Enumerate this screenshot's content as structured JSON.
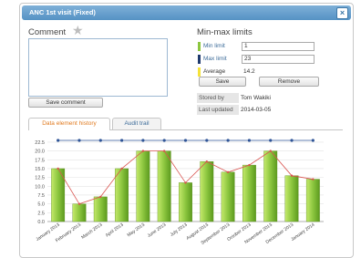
{
  "dialog": {
    "title": "ANC 1st visit (Fixed)",
    "close_label": "×"
  },
  "comment": {
    "title": "Comment",
    "value": "",
    "save_label": "Save comment"
  },
  "minmax": {
    "title": "Min-max limits",
    "min": {
      "label": "Min limit",
      "value": "1",
      "color": "#8cc63f"
    },
    "max": {
      "label": "Max limit",
      "value": "23",
      "color": "#1f3a6e"
    },
    "avg": {
      "label": "Average",
      "value": "14.2",
      "color": "#f5e23a"
    },
    "save_label": "Save",
    "remove_label": "Remove"
  },
  "meta": {
    "stored_by_label": "Stored by",
    "stored_by": "Tom Wakiki",
    "updated_label": "Last updated",
    "updated": "2014-03-05"
  },
  "tabs": [
    {
      "label": "Data element history"
    },
    {
      "label": "Audit trail"
    }
  ],
  "chart_data": {
    "type": "bar",
    "categories": [
      "January 2013",
      "February 2013",
      "March 2013",
      "April 2013",
      "May 2013",
      "June 2013",
      "July 2013",
      "August 2013",
      "September 2013",
      "October 2013",
      "November 2013",
      "December 2013",
      "January 2014"
    ],
    "series": [
      {
        "type": "bar",
        "values": [
          15,
          5,
          7,
          15,
          20,
          20,
          11,
          17,
          14,
          16,
          20,
          13,
          12
        ],
        "color": "#8cc63f"
      },
      {
        "type": "line",
        "values": [
          15,
          5,
          7,
          15,
          20,
          20,
          11,
          17,
          14,
          16,
          20,
          13,
          12
        ],
        "color": "#d9534f"
      },
      {
        "type": "line",
        "values": [
          23,
          23,
          23,
          23,
          23,
          23,
          23,
          23,
          23,
          23,
          23,
          23,
          23
        ],
        "color": "#2f5597"
      }
    ],
    "yticks": [
      "0.0",
      "2.5",
      "5.0",
      "7.5",
      "10.0",
      "12.5",
      "15.0",
      "17.5",
      "20.0",
      "22.5"
    ],
    "ylim": [
      0,
      23
    ],
    "grid": true
  }
}
